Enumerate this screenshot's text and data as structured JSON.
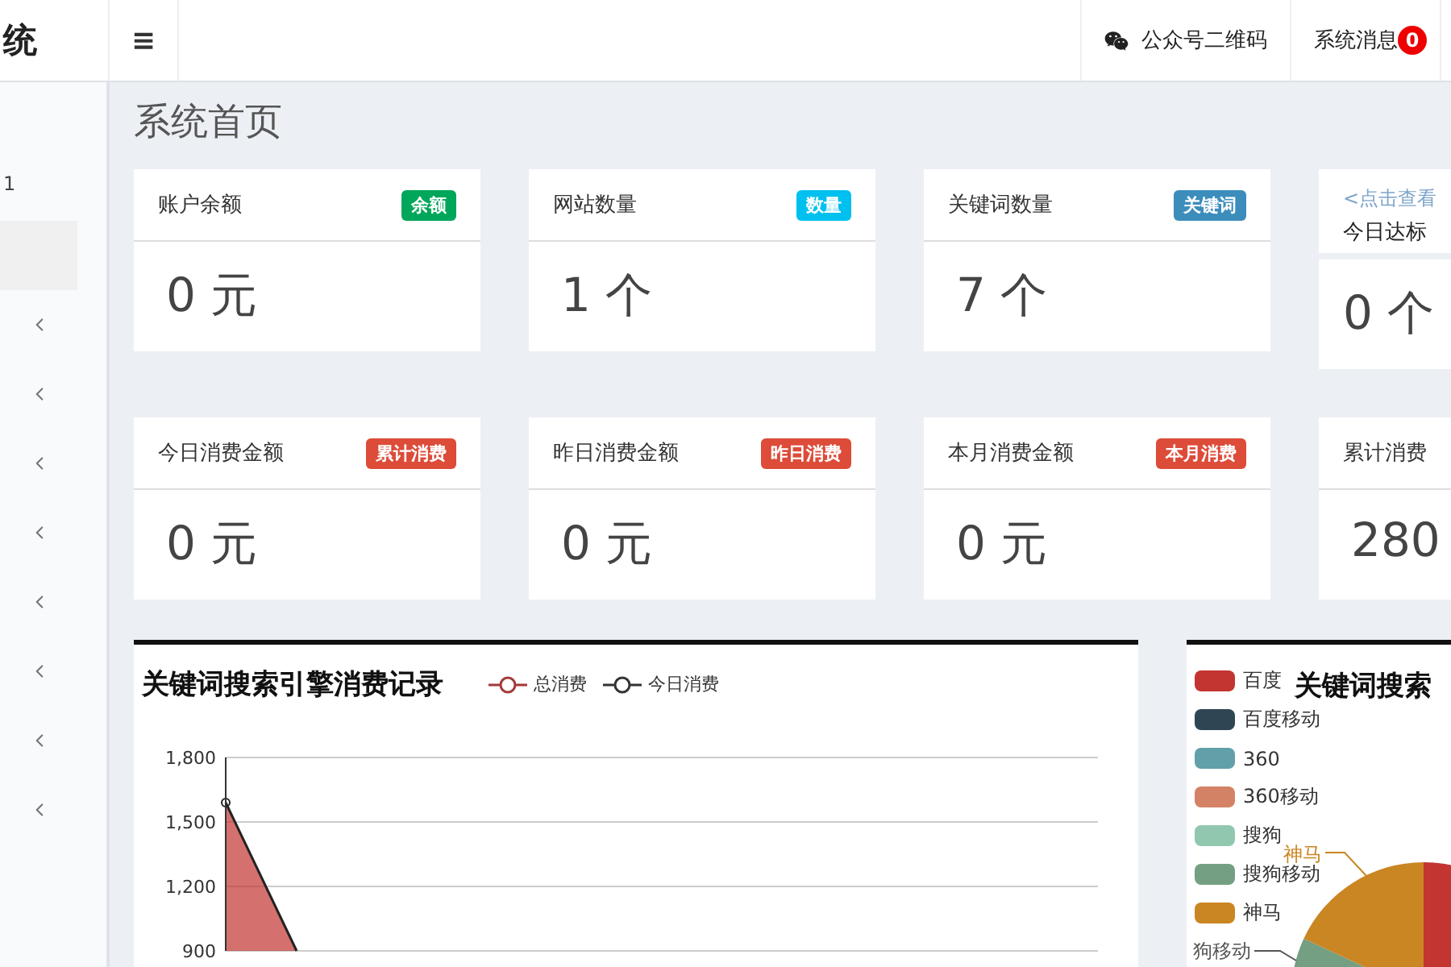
{
  "header": {
    "logo": "统",
    "menu_toggle": "≡",
    "nav": [
      {
        "kind": "wechat",
        "label": "公众号二维码"
      },
      {
        "kind": "messages",
        "label": "系统消息",
        "badge": "0"
      }
    ]
  },
  "sidebar": {
    "user_fragment": "1",
    "items": [
      {
        "selected": true,
        "expandable": false
      },
      {
        "selected": false,
        "expandable": true
      },
      {
        "selected": false,
        "expandable": true
      },
      {
        "selected": false,
        "expandable": true
      },
      {
        "selected": false,
        "expandable": true
      },
      {
        "selected": false,
        "expandable": true
      },
      {
        "selected": false,
        "expandable": true
      },
      {
        "selected": false,
        "expandable": true
      },
      {
        "selected": false,
        "expandable": true
      }
    ]
  },
  "page_title": "系统首页",
  "card_rows": [
    [
      {
        "kind": "stat",
        "title": "账户余额",
        "tag": "余额",
        "color": "#00a65a",
        "value": "0 元"
      },
      {
        "kind": "stat",
        "title": "网站数量",
        "tag": "数量",
        "color": "#00c0ef",
        "value": "1 个"
      },
      {
        "kind": "stat",
        "title": "关键词数量",
        "tag": "关键词",
        "color": "#3c8dbc",
        "value": "7 个"
      },
      {
        "kind": "link",
        "link": "<点击查看",
        "title": "今日达标",
        "value": "0 个"
      }
    ],
    [
      {
        "kind": "stat",
        "title": "今日消费金额",
        "tag": "累计消费",
        "color": "#dd4b39",
        "value": "0 元"
      },
      {
        "kind": "stat",
        "title": "昨日消费金额",
        "tag": "昨日消费",
        "color": "#dd4b39",
        "value": "0 元"
      },
      {
        "kind": "stat",
        "title": "本月消费金额",
        "tag": "本月消费",
        "color": "#dd4b39",
        "value": "0 元"
      },
      {
        "kind": "plain",
        "title": "累计消费",
        "value": "280"
      }
    ]
  ],
  "line_panel": {
    "title": "关键词搜索引擎消费记录",
    "legend": [
      {
        "name": "总消费",
        "color": "#a33a3a"
      },
      {
        "name": "今日消费",
        "color": "#333333"
      }
    ],
    "y_axis_labels": [
      "1,800",
      "1,500",
      "1,200",
      "900"
    ]
  },
  "pie_panel": {
    "title": "关键词搜索",
    "legend": [
      {
        "name": "百度",
        "color": "#c23531"
      },
      {
        "name": "百度移动",
        "color": "#2f4554"
      },
      {
        "name": "360",
        "color": "#61a0a8"
      },
      {
        "name": "360移动",
        "color": "#d48265"
      },
      {
        "name": "搜狗",
        "color": "#91c7ae"
      },
      {
        "name": "搜狗移动",
        "color": "#749f83"
      },
      {
        "name": "神马",
        "color": "#ca8622"
      }
    ],
    "slice_labels": [
      {
        "text": "神马",
        "color": "#ca8622"
      },
      {
        "text": "狗移动",
        "color": "#555555"
      }
    ]
  }
}
